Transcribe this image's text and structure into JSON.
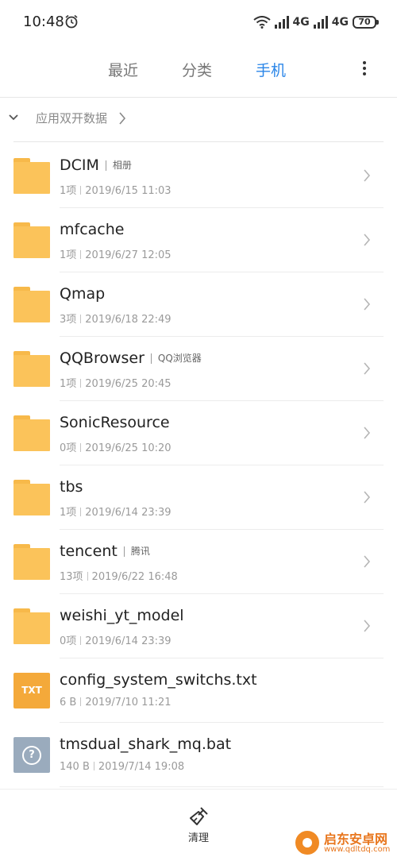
{
  "status_bar": {
    "time": "10:48",
    "net1": "4G",
    "net2": "4G",
    "battery": "70"
  },
  "tabs": [
    {
      "label": "最近",
      "active": false
    },
    {
      "label": "分类",
      "active": false
    },
    {
      "label": "手机",
      "active": true
    }
  ],
  "dual_app": {
    "label": "应用双开数据"
  },
  "files": [
    {
      "name": "DCIM",
      "tag": "相册",
      "count": "1项",
      "date": "2019/6/15 11:03",
      "type": "folder"
    },
    {
      "name": "mfcache",
      "tag": "",
      "count": "1项",
      "date": "2019/6/27 12:05",
      "type": "folder"
    },
    {
      "name": "Qmap",
      "tag": "",
      "count": "3项",
      "date": "2019/6/18 22:49",
      "type": "folder"
    },
    {
      "name": "QQBrowser",
      "tag": "QQ浏览器",
      "count": "1项",
      "date": "2019/6/25 20:45",
      "type": "folder"
    },
    {
      "name": "SonicResource",
      "tag": "",
      "count": "0项",
      "date": "2019/6/25 10:20",
      "type": "folder"
    },
    {
      "name": "tbs",
      "tag": "",
      "count": "1项",
      "date": "2019/6/14 23:39",
      "type": "folder"
    },
    {
      "name": "tencent",
      "tag": "腾讯",
      "count": "13项",
      "date": "2019/6/22 16:48",
      "type": "folder"
    },
    {
      "name": "weishi_yt_model",
      "tag": "",
      "count": "0项",
      "date": "2019/6/14 23:39",
      "type": "folder"
    },
    {
      "name": "config_system_switchs.txt",
      "tag": "",
      "count": "6 B",
      "date": "2019/7/10 11:21",
      "type": "txt",
      "icon_label": "TXT"
    },
    {
      "name": "tmsdual_shark_mq.bat",
      "tag": "",
      "count": "140 B",
      "date": "2019/7/14 19:08",
      "type": "unknown",
      "icon_label": "?"
    }
  ],
  "bottom_bar": {
    "clean_label": "清理"
  },
  "watermark": {
    "title": "启东安卓网",
    "url": "www.qdltdq.com"
  },
  "colors": {
    "accent": "#2b86e8",
    "folder": "#fbc35a",
    "txt": "#f4a93a",
    "unknown": "#9aabbd"
  }
}
